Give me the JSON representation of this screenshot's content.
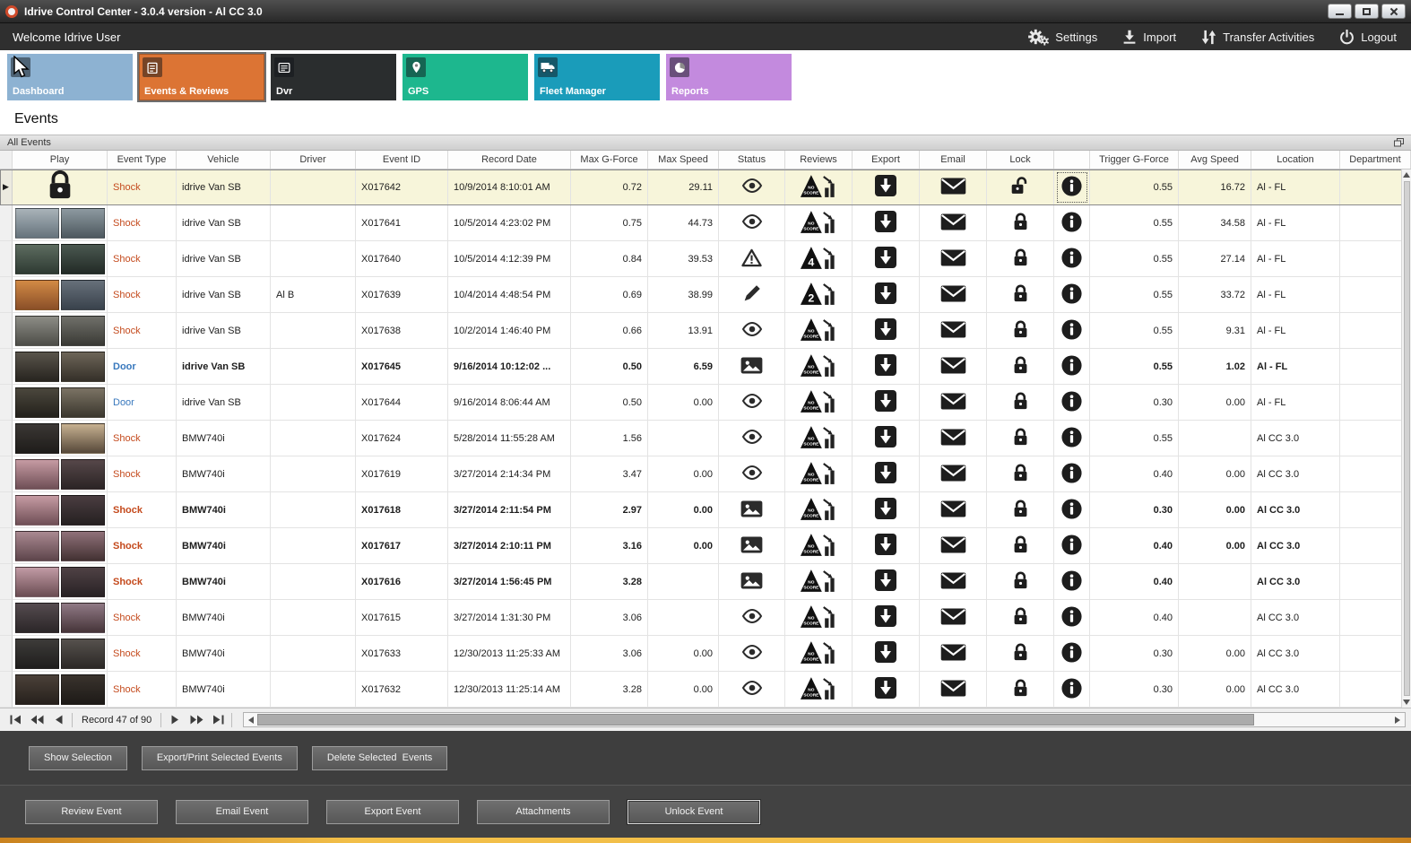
{
  "window": {
    "title": "Idrive Control Center - 3.0.4 version - Al CC 3.0"
  },
  "topbar": {
    "welcome": "Welcome Idrive User",
    "menu": [
      {
        "id": "settings",
        "label": "Settings"
      },
      {
        "id": "import",
        "label": "Import"
      },
      {
        "id": "transfer-activities",
        "label": "Transfer Activities"
      },
      {
        "id": "logout",
        "label": "Logout"
      }
    ]
  },
  "nav_tiles": [
    {
      "id": "dashboard",
      "label": "Dashboard",
      "color": "#8db2d2",
      "selected": false
    },
    {
      "id": "events",
      "label": "Events & Reviews",
      "color": "#dc7434",
      "selected": true
    },
    {
      "id": "dvr",
      "label": "Dvr",
      "color": "#2a2d2e",
      "selected": false
    },
    {
      "id": "gps",
      "label": "GPS",
      "color": "#1db78e",
      "selected": false
    },
    {
      "id": "fleet",
      "label": "Fleet Manager",
      "color": "#1a9cba",
      "selected": false
    },
    {
      "id": "reports",
      "label": "Reports",
      "color": "#c38ade",
      "selected": false
    }
  ],
  "page": {
    "title": "Events",
    "group_header": "All Events"
  },
  "colors": {
    "shock": "#c44a1d",
    "door": "#3878bd",
    "selected_row_bg": "#f7f5da",
    "accent_strip": "#f2bf49"
  },
  "table": {
    "columns": [
      {
        "key": "play",
        "label": "Play",
        "align": "icon"
      },
      {
        "key": "event_type",
        "label": "Event Type",
        "align": "left"
      },
      {
        "key": "vehicle",
        "label": "Vehicle",
        "align": "left"
      },
      {
        "key": "driver",
        "label": "Driver",
        "align": "left"
      },
      {
        "key": "event_id",
        "label": "Event ID",
        "align": "left"
      },
      {
        "key": "record_date",
        "label": "Record Date",
        "align": "left"
      },
      {
        "key": "max_g",
        "label": "Max G-Force",
        "align": "right"
      },
      {
        "key": "max_speed",
        "label": "Max Speed",
        "align": "right"
      },
      {
        "key": "status",
        "label": "Status",
        "align": "icon"
      },
      {
        "key": "reviews",
        "label": "Reviews",
        "align": "icon"
      },
      {
        "key": "export",
        "label": "Export",
        "align": "icon"
      },
      {
        "key": "email",
        "label": "Email",
        "align": "icon"
      },
      {
        "key": "lock",
        "label": "Lock",
        "align": "icon"
      },
      {
        "key": "info",
        "label": "",
        "align": "icon"
      },
      {
        "key": "trigger_g",
        "label": "Trigger G-Force",
        "align": "right"
      },
      {
        "key": "avg_speed",
        "label": "Avg Speed",
        "align": "right"
      },
      {
        "key": "location",
        "label": "Location",
        "align": "left"
      },
      {
        "key": "department",
        "label": "Department",
        "align": "left"
      }
    ],
    "rows": [
      {
        "selected": true,
        "bold": false,
        "play": "lock",
        "type": "shock",
        "event_type": "Shock",
        "vehicle": "idrive Van SB",
        "driver": "",
        "event_id": "X017642",
        "record_date": "10/9/2014 8:10:01 AM",
        "max_g": "0.72",
        "max_speed": "29.11",
        "status": "eye",
        "review": "NO SCORE",
        "locked": false,
        "trigger_g": "0.55",
        "avg_speed": "16.72",
        "location": "Al - FL"
      },
      {
        "selected": false,
        "bold": false,
        "play": "thumb",
        "thumb": [
          "#a9b3b9",
          "#66737c",
          "#8d99a0",
          "#4d585f"
        ],
        "type": "shock",
        "event_type": "Shock",
        "vehicle": "idrive Van SB",
        "driver": "",
        "event_id": "X017641",
        "record_date": "10/5/2014 4:23:02 PM",
        "max_g": "0.75",
        "max_speed": "44.73",
        "status": "eye",
        "review": "NO SCORE",
        "locked": true,
        "trigger_g": "0.55",
        "avg_speed": "34.58",
        "location": "Al - FL"
      },
      {
        "selected": false,
        "bold": false,
        "play": "thumb",
        "thumb": [
          "#5d6c60",
          "#2e3a32",
          "#4a5850",
          "#222a26"
        ],
        "type": "shock",
        "event_type": "Shock",
        "vehicle": "idrive Van SB",
        "driver": "",
        "event_id": "X017640",
        "record_date": "10/5/2014 4:12:39 PM",
        "max_g": "0.84",
        "max_speed": "39.53",
        "status": "warning",
        "review": "4",
        "locked": true,
        "trigger_g": "0.55",
        "avg_speed": "27.14",
        "location": "Al - FL"
      },
      {
        "selected": false,
        "bold": false,
        "play": "thumb",
        "thumb": [
          "#d28a45",
          "#8a4f28",
          "#67707a",
          "#39424c"
        ],
        "type": "shock",
        "event_type": "Shock",
        "vehicle": "idrive Van SB",
        "driver": "Al B",
        "event_id": "X017639",
        "record_date": "10/4/2014 4:48:54 PM",
        "max_g": "0.69",
        "max_speed": "38.99",
        "status": "pencil",
        "review": "2",
        "locked": true,
        "trigger_g": "0.55",
        "avg_speed": "33.72",
        "location": "Al - FL"
      },
      {
        "selected": false,
        "bold": false,
        "play": "thumb",
        "thumb": [
          "#8d8d86",
          "#4d4d48",
          "#70706a",
          "#3a3a35"
        ],
        "type": "shock",
        "event_type": "Shock",
        "vehicle": "idrive Van SB",
        "driver": "",
        "event_id": "X017638",
        "record_date": "10/2/2014 1:46:40 PM",
        "max_g": "0.66",
        "max_speed": "13.91",
        "status": "eye",
        "review": "NO SCORE",
        "locked": true,
        "trigger_g": "0.55",
        "avg_speed": "9.31",
        "location": "Al - FL"
      },
      {
        "selected": false,
        "bold": true,
        "play": "thumb",
        "thumb": [
          "#59544b",
          "#27241f",
          "#6d6558",
          "#342f28"
        ],
        "type": "door",
        "event_type": "Door",
        "vehicle": "idrive Van SB",
        "driver": "",
        "event_id": "X017645",
        "record_date": "9/16/2014 10:12:02 ...",
        "max_g": "0.50",
        "max_speed": "6.59",
        "status": "image",
        "review": "NO SCORE",
        "locked": true,
        "trigger_g": "0.55",
        "avg_speed": "1.02",
        "location": "Al - FL"
      },
      {
        "selected": false,
        "bold": false,
        "play": "thumb",
        "thumb": [
          "#4b473d",
          "#23211b",
          "#7b7364",
          "#3b372e"
        ],
        "type": "door",
        "event_type": "Door",
        "vehicle": "idrive Van SB",
        "driver": "",
        "event_id": "X017644",
        "record_date": "9/16/2014 8:06:44 AM",
        "max_g": "0.50",
        "max_speed": "0.00",
        "status": "eye",
        "review": "NO SCORE",
        "locked": true,
        "trigger_g": "0.30",
        "avg_speed": "0.00",
        "location": "Al - FL"
      },
      {
        "selected": false,
        "bold": false,
        "play": "thumb",
        "thumb": [
          "#3b3734",
          "#1e1c1a",
          "#c7b191",
          "#564839"
        ],
        "type": "shock",
        "event_type": "Shock",
        "vehicle": "BMW740i",
        "driver": "",
        "event_id": "X017624",
        "record_date": "5/28/2014 11:55:28 AM",
        "max_g": "1.56",
        "max_speed": "",
        "status": "eye",
        "review": "NO SCORE",
        "locked": true,
        "trigger_g": "0.55",
        "avg_speed": "",
        "location": "Al CC 3.0"
      },
      {
        "selected": false,
        "bold": false,
        "play": "thumb",
        "thumb": [
          "#c69ba3",
          "#6f4f56",
          "#564749",
          "#2b2425"
        ],
        "type": "shock",
        "event_type": "Shock",
        "vehicle": "BMW740i",
        "driver": "",
        "event_id": "X017619",
        "record_date": "3/27/2014 2:14:34 PM",
        "max_g": "3.47",
        "max_speed": "0.00",
        "status": "eye",
        "review": "NO SCORE",
        "locked": true,
        "trigger_g": "0.40",
        "avg_speed": "0.00",
        "location": "Al CC 3.0"
      },
      {
        "selected": false,
        "bold": true,
        "play": "thumb",
        "thumb": [
          "#c69ba3",
          "#6f4f56",
          "#4a3d41",
          "#252021"
        ],
        "type": "shock",
        "event_type": "Shock",
        "vehicle": "BMW740i",
        "driver": "",
        "event_id": "X017618",
        "record_date": "3/27/2014 2:11:54 PM",
        "max_g": "2.97",
        "max_speed": "0.00",
        "status": "image",
        "review": "NO SCORE",
        "locked": true,
        "trigger_g": "0.30",
        "avg_speed": "0.00",
        "location": "Al CC 3.0"
      },
      {
        "selected": false,
        "bold": true,
        "play": "thumb",
        "thumb": [
          "#aa8991",
          "#5d454b",
          "#907179",
          "#423132"
        ],
        "type": "shock",
        "event_type": "Shock",
        "vehicle": "BMW740i",
        "driver": "",
        "event_id": "X017617",
        "record_date": "3/27/2014 2:10:11 PM",
        "max_g": "3.16",
        "max_speed": "0.00",
        "status": "image",
        "review": "NO SCORE",
        "locked": true,
        "trigger_g": "0.40",
        "avg_speed": "0.00",
        "location": "Al CC 3.0"
      },
      {
        "selected": false,
        "bold": true,
        "play": "thumb",
        "thumb": [
          "#c19ba5",
          "#6b4d53",
          "#4f4145",
          "#282224"
        ],
        "type": "shock",
        "event_type": "Shock",
        "vehicle": "BMW740i",
        "driver": "",
        "event_id": "X017616",
        "record_date": "3/27/2014 1:56:45 PM",
        "max_g": "3.28",
        "max_speed": "",
        "status": "image",
        "review": "NO SCORE",
        "locked": true,
        "trigger_g": "0.40",
        "avg_speed": "",
        "location": "Al CC 3.0"
      },
      {
        "selected": false,
        "bold": false,
        "play": "thumb",
        "thumb": [
          "#554b4f",
          "#2b2628",
          "#907985",
          "#463539"
        ],
        "type": "shock",
        "event_type": "Shock",
        "vehicle": "BMW740i",
        "driver": "",
        "event_id": "X017615",
        "record_date": "3/27/2014 1:31:30 PM",
        "max_g": "3.06",
        "max_speed": "",
        "status": "eye",
        "review": "NO SCORE",
        "locked": true,
        "trigger_g": "0.40",
        "avg_speed": "",
        "location": "Al CC 3.0"
      },
      {
        "selected": false,
        "bold": false,
        "play": "thumb",
        "thumb": [
          "#3d3b39",
          "#1f1e1d",
          "#56514d",
          "#2b2826"
        ],
        "type": "shock",
        "event_type": "Shock",
        "vehicle": "BMW740i",
        "driver": "",
        "event_id": "X017633",
        "record_date": "12/30/2013 11:25:33 AM",
        "max_g": "3.06",
        "max_speed": "0.00",
        "status": "eye",
        "review": "NO SCORE",
        "locked": true,
        "trigger_g": "0.30",
        "avg_speed": "0.00",
        "location": "Al CC 3.0"
      },
      {
        "selected": false,
        "bold": false,
        "play": "thumb",
        "thumb": [
          "#4b4139",
          "#26201c",
          "#3a332d",
          "#1d1a17"
        ],
        "type": "shock",
        "event_type": "Shock",
        "vehicle": "BMW740i",
        "driver": "",
        "event_id": "X017632",
        "record_date": "12/30/2013 11:25:14 AM",
        "max_g": "3.28",
        "max_speed": "0.00",
        "status": "eye",
        "review": "NO SCORE",
        "locked": true,
        "trigger_g": "0.30",
        "avg_speed": "0.00",
        "location": "Al CC 3.0"
      }
    ]
  },
  "pager": {
    "record_label": "Record 47 of 90"
  },
  "selection_actions": [
    "Show Selection",
    "Export/Print Selected Events",
    "Delete Selected  Events"
  ],
  "event_actions": [
    "Review Event",
    "Email Event",
    "Export Event",
    "Attachments",
    "Unlock Event"
  ]
}
